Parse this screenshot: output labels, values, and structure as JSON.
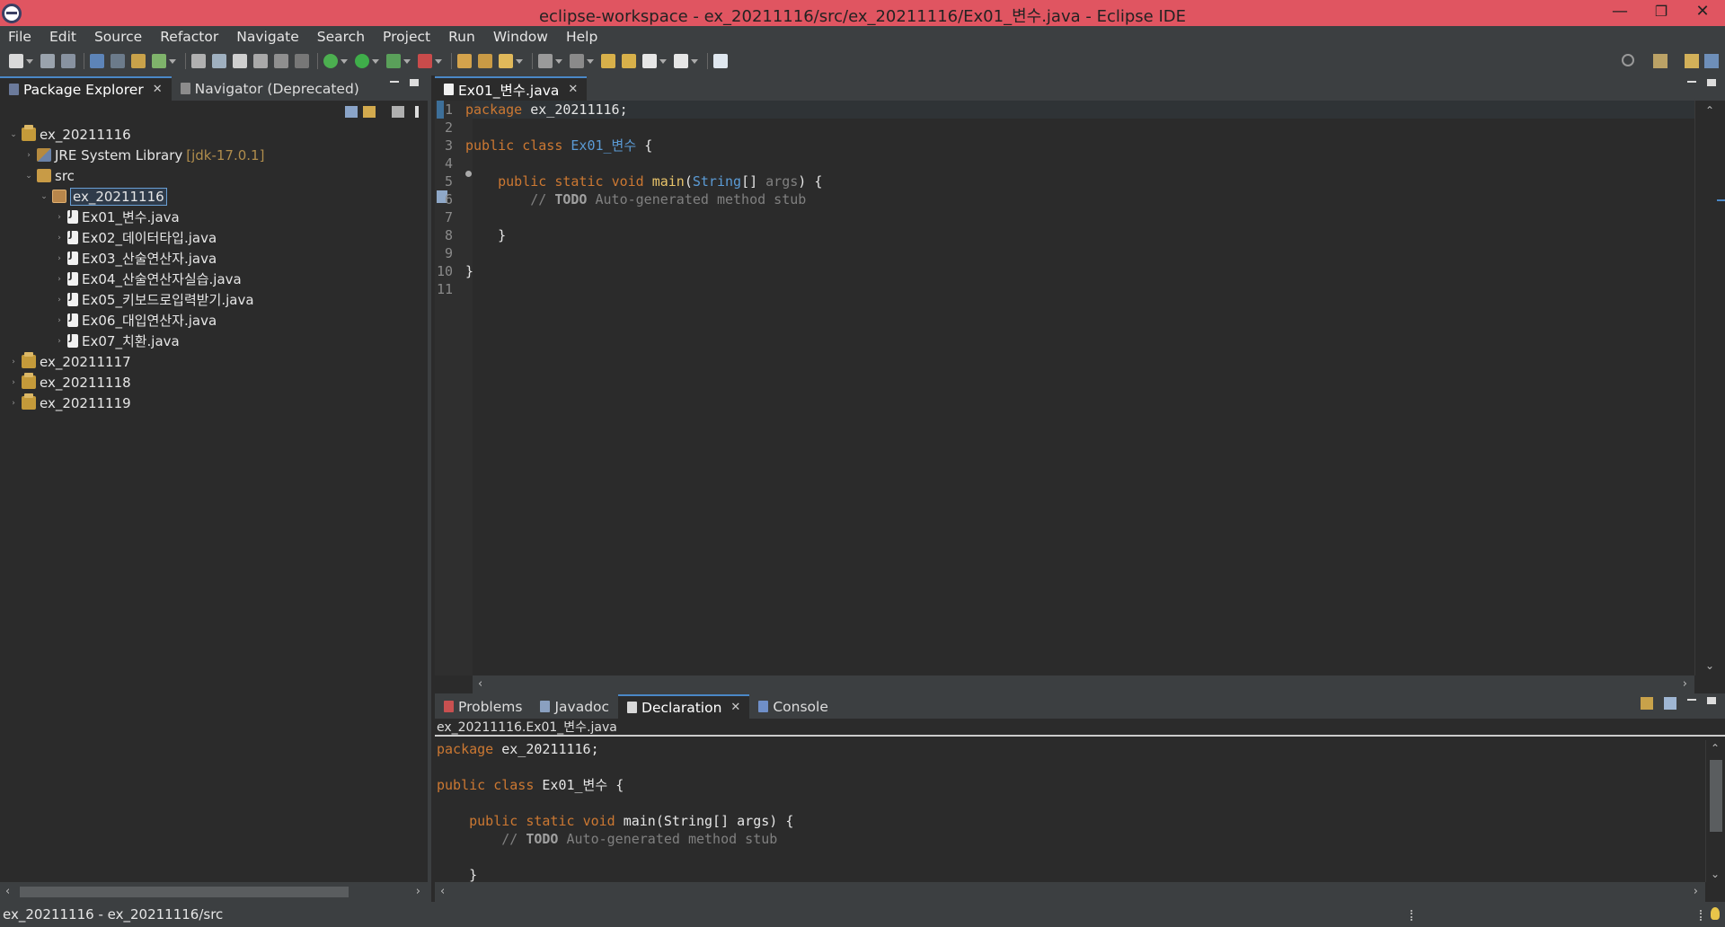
{
  "window": {
    "title": "eclipse-workspace - ex_20211116/src/ex_20211116/Ex01_변수.java - Eclipse IDE",
    "minimize": "—",
    "restore": "❐",
    "close": "✕"
  },
  "menu": [
    "File",
    "Edit",
    "Source",
    "Refactor",
    "Navigate",
    "Search",
    "Project",
    "Run",
    "Window",
    "Help"
  ],
  "left_view": {
    "tabs": [
      {
        "label": "Package Explorer",
        "close": "✕",
        "active": true
      },
      {
        "label": "Navigator (Deprecated)",
        "active": false
      }
    ],
    "tree": [
      {
        "label": "ex_20211116",
        "icon": "project-icon",
        "twist": "⌄",
        "level": 0
      },
      {
        "label": "JRE System Library",
        "deco": "[jdk-17.0.1]",
        "icon": "library-icon",
        "twist": "›",
        "level": 1
      },
      {
        "label": "src",
        "icon": "source-folder-icon",
        "twist": "⌄",
        "level": 1
      },
      {
        "label": "ex_20211116",
        "icon": "package-icon",
        "twist": "⌄",
        "level": 2,
        "selected": true
      },
      {
        "label": "Ex01_변수.java",
        "icon": "java-file-icon",
        "twist": "›",
        "level": 3
      },
      {
        "label": "Ex02_데이터타입.java",
        "icon": "java-file-icon",
        "twist": "›",
        "level": 3
      },
      {
        "label": "Ex03_산술연산자.java",
        "icon": "java-file-icon",
        "twist": "›",
        "level": 3
      },
      {
        "label": "Ex04_산술연산자실습.java",
        "icon": "java-file-icon",
        "twist": "›",
        "level": 3
      },
      {
        "label": "Ex05_키보드로입력받기.java",
        "icon": "java-file-icon",
        "twist": "›",
        "level": 3
      },
      {
        "label": "Ex06_대입연산자.java",
        "icon": "java-file-icon",
        "twist": "›",
        "level": 3
      },
      {
        "label": "Ex07_치환.java",
        "icon": "java-file-icon",
        "twist": "›",
        "level": 3
      },
      {
        "label": "ex_20211117",
        "icon": "project-icon",
        "twist": "›",
        "level": 0
      },
      {
        "label": "ex_20211118",
        "icon": "project-icon",
        "twist": "›",
        "level": 0
      },
      {
        "label": "ex_20211119",
        "icon": "project-icon",
        "twist": "›",
        "level": 0
      }
    ]
  },
  "editor": {
    "tab_label": "Ex01_변수.java",
    "tab_close": "✕",
    "lines": [
      {
        "n": "1",
        "parts": [
          [
            "kw",
            "package"
          ],
          [
            "plain",
            " ex_20211116;"
          ]
        ]
      },
      {
        "n": "2",
        "parts": []
      },
      {
        "n": "3",
        "parts": [
          [
            "kw",
            "public"
          ],
          [
            "plain",
            " "
          ],
          [
            "kw",
            "class"
          ],
          [
            "plain",
            " "
          ],
          [
            "ty",
            "Ex01_변수"
          ],
          [
            "plain",
            " {"
          ]
        ]
      },
      {
        "n": "4",
        "parts": []
      },
      {
        "n": "5",
        "parts": [
          [
            "plain",
            "    "
          ],
          [
            "kw",
            "public"
          ],
          [
            "plain",
            " "
          ],
          [
            "kw",
            "static"
          ],
          [
            "plain",
            " "
          ],
          [
            "kw",
            "void"
          ],
          [
            "plain",
            " "
          ],
          [
            "fn",
            "main"
          ],
          [
            "plain",
            "("
          ],
          [
            "ty",
            "String"
          ],
          [
            "plain",
            "[] "
          ],
          [
            "cm",
            "args"
          ],
          [
            "plain",
            ") {"
          ]
        ]
      },
      {
        "n": "6",
        "parts": [
          [
            "cm",
            "        // "
          ],
          [
            "todo",
            "TODO"
          ],
          [
            "cm",
            " Auto-generated method stub"
          ]
        ]
      },
      {
        "n": "7",
        "parts": []
      },
      {
        "n": "8",
        "parts": [
          [
            "plain",
            "    }"
          ]
        ]
      },
      {
        "n": "9",
        "parts": []
      },
      {
        "n": "10",
        "parts": [
          [
            "plain",
            "}"
          ]
        ]
      },
      {
        "n": "11",
        "parts": []
      }
    ]
  },
  "bottom_view": {
    "tabs": [
      {
        "label": "Problems",
        "active": false
      },
      {
        "label": "Javadoc",
        "active": false
      },
      {
        "label": "Declaration",
        "active": true,
        "close": "✕"
      },
      {
        "label": "Console",
        "active": false
      }
    ],
    "path": "ex_20211116.Ex01_변수.java",
    "lines": [
      {
        "parts": [
          [
            "kw",
            "package"
          ],
          [
            "plain",
            " ex_20211116;"
          ]
        ]
      },
      {
        "parts": []
      },
      {
        "parts": [
          [
            "kw",
            "public"
          ],
          [
            "plain",
            " "
          ],
          [
            "kw",
            "class"
          ],
          [
            "plain",
            " Ex01_변수 {"
          ]
        ]
      },
      {
        "parts": []
      },
      {
        "parts": [
          [
            "plain",
            "    "
          ],
          [
            "kw",
            "public"
          ],
          [
            "plain",
            " "
          ],
          [
            "kw",
            "static"
          ],
          [
            "plain",
            " "
          ],
          [
            "kw",
            "void"
          ],
          [
            "plain",
            " main(String[] args) {"
          ]
        ]
      },
      {
        "parts": [
          [
            "cm",
            "        // "
          ],
          [
            "todo",
            "TODO"
          ],
          [
            "cm",
            " Auto-generated method stub"
          ]
        ]
      },
      {
        "parts": []
      },
      {
        "parts": [
          [
            "plain",
            "    }"
          ]
        ]
      }
    ]
  },
  "status": {
    "text": "ex_20211116 - ex_20211116/src"
  },
  "scroll": {
    "left": "‹",
    "right": "›",
    "up": "⌃",
    "down": "⌄"
  }
}
